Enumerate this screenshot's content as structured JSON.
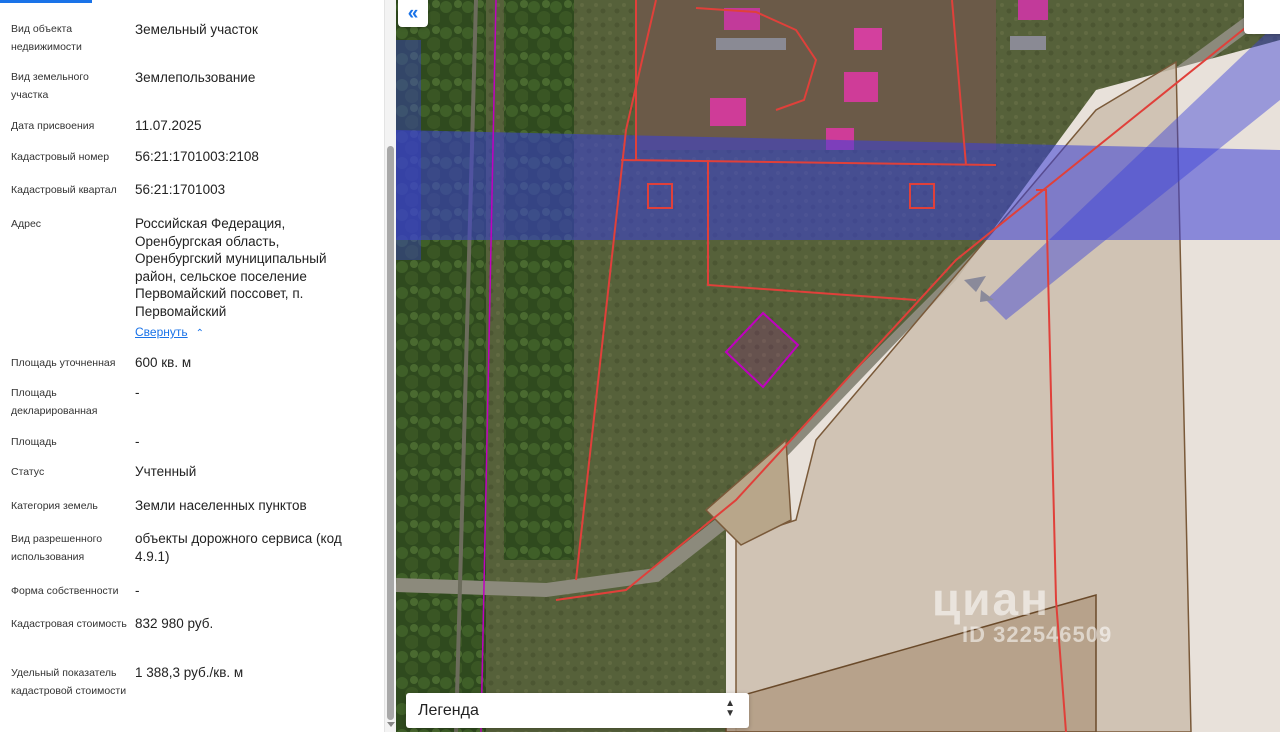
{
  "properties": [
    {
      "label": "Вид объекта недвижимости",
      "value": "Земельный участок"
    },
    {
      "label": "Вид земельного участка",
      "value": "Землепользование"
    },
    {
      "label": "Дата присвоения",
      "value": "11.07.2025"
    },
    {
      "label": "Кадастровый номер",
      "value": "56:21:1701003:2108"
    },
    {
      "label": "Кадастровый квартал",
      "value": "56:21:1701003"
    },
    {
      "label": "Адрес",
      "value": "Российская Федерация, Оренбургская область, Оренбургский муниципальный район, сельское поселение Первомайский поссовет, п. Первомайский"
    },
    {
      "label": "Площадь уточненная",
      "value": "600 кв. м"
    },
    {
      "label": "Площадь декларированная",
      "value": "-"
    },
    {
      "label": "Площадь",
      "value": "-"
    },
    {
      "label": "Статус",
      "value": "Учтенный"
    },
    {
      "label": "Категория земель",
      "value": "Земли населенных пунктов"
    },
    {
      "label": "Вид разрешенного использования",
      "value": "объекты дорожного сервиса (код 4.9.1)"
    },
    {
      "label": "Форма собственности",
      "value": "-"
    },
    {
      "label": "Кадастровая стоимость",
      "value": "832 980 руб."
    },
    {
      "label": "Удельный показатель кадастровой стоимости",
      "value": "1 388,3 руб./кв. м"
    }
  ],
  "address_toggle": "Свернуть",
  "map": {
    "collapse_icon": "«",
    "legend_label": "Легенда",
    "watermark_logo": "циан",
    "watermark_id": "ID 322546509"
  },
  "colors": {
    "accent": "#1a73e8",
    "zone_blue": "#3a40d8",
    "parcel_red": "#e0403a",
    "selected_parcel": "#c000c0"
  }
}
